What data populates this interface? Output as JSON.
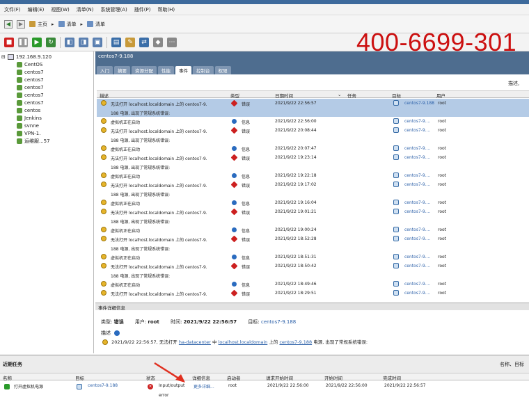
{
  "window": {
    "title": "192.168.9.120 - vSphere Client"
  },
  "menu": [
    "文件(F)",
    "编辑(E)",
    "视图(W)",
    "清单(N)",
    "系统管理(A)",
    "插件(P)",
    "帮助(H)"
  ],
  "nav": {
    "home": "主页",
    "inventory": "清单",
    "inventory2": "清单"
  },
  "watermark": "400-6699-301",
  "tree": {
    "root": "192.168.9.120",
    "vms": [
      "CentOS",
      "centos7",
      "centos7",
      "centos7",
      "centos7",
      "centos7",
      "centos",
      "Jenkins",
      "svnne",
      "VPN-1.",
      "运维服...57"
    ]
  },
  "vm_panel": {
    "title": "centos7-9.188",
    "tabs": [
      "入门",
      "摘要",
      "资源分配",
      "性能",
      "事件",
      "控制台",
      "权限"
    ],
    "active_tab": "事件",
    "desc_label": "描述,"
  },
  "events_table": {
    "columns": [
      "描述",
      "类型",
      "日期时间",
      "任务",
      "目标",
      "用户"
    ],
    "rows": [
      {
        "desc": "无法打开 localhost.localdomain 上的 centos7-9.",
        "type": "错误",
        "time": "2021/9/22 22:56:57",
        "target": "centos7-9.188",
        "user": "root",
        "sev": "err",
        "selected": true
      },
      {
        "desc": "188 电源, 出现了常规系统错误:",
        "type": "",
        "time": "",
        "target": "",
        "user": "",
        "sev": "",
        "cont": true,
        "selected": true
      },
      {
        "desc": "虚拟机正在启动",
        "type": "信息",
        "time": "2021/9/22 22:56:00",
        "target": "centos7-9....",
        "user": "root",
        "sev": "info"
      },
      {
        "desc": "无法打开 localhost.localdomain 上的 centos7-9.",
        "type": "错误",
        "time": "2021/9/22 20:08:44",
        "target": "centos7-9....",
        "user": "root",
        "sev": "err"
      },
      {
        "desc": "188 电源, 出现了常规系统错误:",
        "type": "",
        "time": "",
        "target": "",
        "user": "",
        "sev": "",
        "cont": true
      },
      {
        "desc": "虚拟机正在启动",
        "type": "信息",
        "time": "2021/9/22 20:07:47",
        "target": "centos7-9....",
        "user": "root",
        "sev": "info"
      },
      {
        "desc": "无法打开 localhost.localdomain 上的 centos7-9.",
        "type": "错误",
        "time": "2021/9/22 19:23:14",
        "target": "centos7-9....",
        "user": "root",
        "sev": "err"
      },
      {
        "desc": "188 电源, 出现了常规系统错误:",
        "type": "",
        "time": "",
        "target": "",
        "user": "",
        "sev": "",
        "cont": true
      },
      {
        "desc": "虚拟机正在启动",
        "type": "信息",
        "time": "2021/9/22 19:22:18",
        "target": "centos7-9....",
        "user": "root",
        "sev": "info"
      },
      {
        "desc": "无法打开 localhost.localdomain 上的 centos7-9.",
        "type": "错误",
        "time": "2021/9/22 19:17:02",
        "target": "centos7-9....",
        "user": "root",
        "sev": "err"
      },
      {
        "desc": "188 电源, 出现了常规系统错误:",
        "type": "",
        "time": "",
        "target": "",
        "user": "",
        "sev": "",
        "cont": true
      },
      {
        "desc": "虚拟机正在启动",
        "type": "信息",
        "time": "2021/9/22 19:16:04",
        "target": "centos7-9....",
        "user": "root",
        "sev": "info"
      },
      {
        "desc": "无法打开 localhost.localdomain 上的 centos7-9.",
        "type": "错误",
        "time": "2021/9/22 19:01:21",
        "target": "centos7-9....",
        "user": "root",
        "sev": "err"
      },
      {
        "desc": "188 电源, 出现了常规系统错误:",
        "type": "",
        "time": "",
        "target": "",
        "user": "",
        "sev": "",
        "cont": true
      },
      {
        "desc": "虚拟机正在启动",
        "type": "信息",
        "time": "2021/9/22 19:00:24",
        "target": "centos7-9....",
        "user": "root",
        "sev": "info"
      },
      {
        "desc": "无法打开 localhost.localdomain 上的 centos7-9.",
        "type": "错误",
        "time": "2021/9/22 18:52:28",
        "target": "centos7-9....",
        "user": "root",
        "sev": "err"
      },
      {
        "desc": "188 电源, 出现了常规系统错误:",
        "type": "",
        "time": "",
        "target": "",
        "user": "",
        "sev": "",
        "cont": true
      },
      {
        "desc": "虚拟机正在启动",
        "type": "信息",
        "time": "2021/9/22 18:51:31",
        "target": "centos7-9....",
        "user": "root",
        "sev": "info"
      },
      {
        "desc": "无法打开 localhost.localdomain 上的 centos7-9.",
        "type": "错误",
        "time": "2021/9/22 18:50:42",
        "target": "centos7-9....",
        "user": "root",
        "sev": "err"
      },
      {
        "desc": "188 电源, 出现了常规系统错误:",
        "type": "",
        "time": "",
        "target": "",
        "user": "",
        "sev": "",
        "cont": true
      },
      {
        "desc": "虚拟机正在启动",
        "type": "信息",
        "time": "2021/9/22 18:49:46",
        "target": "centos7-9....",
        "user": "root",
        "sev": "info"
      },
      {
        "desc": "无法打开 localhost.localdomain 上的 centos7-9.",
        "type": "错误",
        "time": "2021/9/22 18:29:51",
        "target": "centos7-9....",
        "user": "root",
        "sev": "err"
      }
    ]
  },
  "event_detail": {
    "header": "事件详细信息",
    "type_label": "类型:",
    "type_value": "错误",
    "user_label": "用户:",
    "user_value": "root",
    "time_label": "时间:",
    "time_value": "2021/9/22 22:56:57",
    "target_label": "目标:",
    "target_value": "centos7-9.188",
    "desc_label": "描述",
    "desc_time": "2021/9/22 22:56:57, 无法打开",
    "desc_link1": "ha-datacenter",
    "desc_mid": "中",
    "desc_link2": "localhost.localdomain",
    "desc_mid2": "上的",
    "desc_link3": "centos7-9.188",
    "desc_tail": "电源, 出现了常规系统错误:"
  },
  "recent_tasks": {
    "title": "近期任务",
    "right_label": "名称、目标",
    "columns": [
      "名称",
      "目标",
      "状态",
      "详细信息",
      "启动者",
      "请求开始时间",
      "开始时间",
      "完成时间"
    ],
    "row": {
      "name": "打开虚拟机电源",
      "target": "centos7-9.188",
      "status": "Input/output",
      "status2": "error",
      "details": "更多详细...",
      "initiator": "root",
      "requested": "2021/9/22 22:56:00",
      "started": "2021/9/22 22:56:00",
      "completed": "2021/9/22 22:56:57"
    }
  },
  "colors": {
    "header_blue": "#4e6d8f",
    "selection": "#b4cbe6",
    "error_red": "#cc2020",
    "info_blue": "#2a6bbf",
    "watermark_red": "#cc1010"
  }
}
